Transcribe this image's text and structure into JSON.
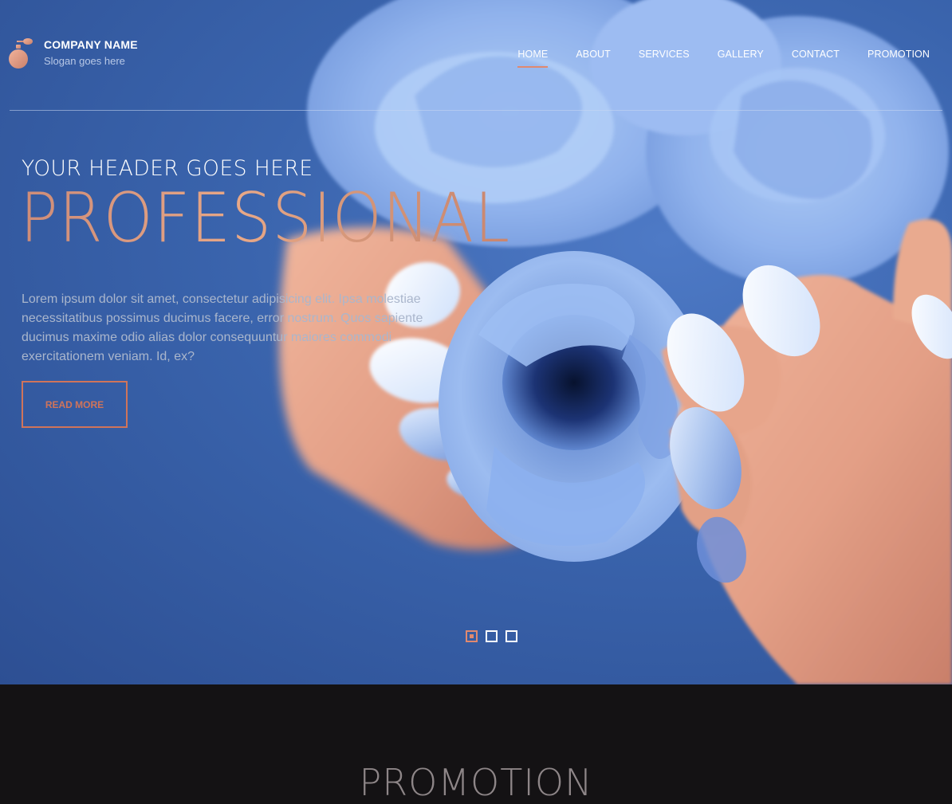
{
  "header": {
    "logo_icon": "perfume-bottle-icon",
    "company_name": "COMPANY NAME",
    "slogan": "Slogan goes here"
  },
  "nav": {
    "items": [
      {
        "label": "HOME",
        "active": true
      },
      {
        "label": "ABOUT",
        "active": false
      },
      {
        "label": "SERVICES",
        "active": false
      },
      {
        "label": "GALLERY",
        "active": false
      },
      {
        "label": "CONTACT",
        "active": false
      },
      {
        "label": "PROMOTION",
        "active": false
      }
    ]
  },
  "hero": {
    "kicker": "YOUR HEADER GOES HERE",
    "title": "PROFESSIONAL",
    "body": "Lorem ipsum dolor sit amet, consectetur adipisicing elit. Ipsa molestiae necessitatibus possimus ducimus facere, error nostrum. Quos sapiente ducimus maxime odio alias dolor consequuntur maiores commodi exercitationem veniam. Id, ex?",
    "cta_label": "READ MORE",
    "slides": {
      "count": 3,
      "active_index": 0
    }
  },
  "promotion": {
    "title": "PROMOTION"
  },
  "colors": {
    "accent": "#e0896f",
    "hero_blue": "#3a64ad",
    "dark_bg": "#141214",
    "nav_text": "#ffffff"
  }
}
